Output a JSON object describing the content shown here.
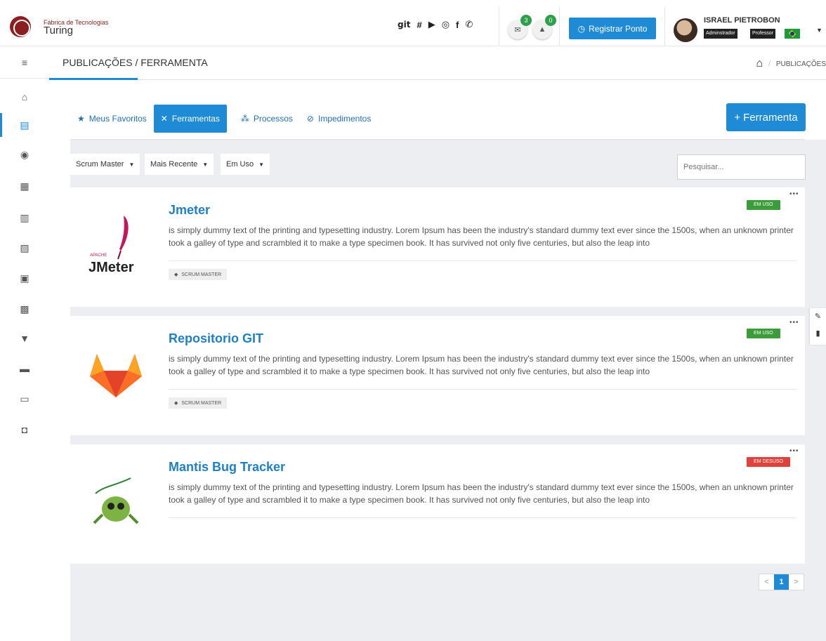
{
  "header": {
    "logo_small": "Fábrica de Tecnologias",
    "logo_big": "Turing",
    "social": [
      "git",
      "slack-icon",
      "youtube-icon",
      "instagram-icon",
      "facebook-icon",
      "whatsapp-icon"
    ],
    "mail_count": "3",
    "notif_count": "0",
    "registrar_label": "Registrar Ponto",
    "user_name": "ISRAEL PIETROBON",
    "roles": [
      "Adminstrador",
      "Professor"
    ]
  },
  "breadcrumb": {
    "title": "PUBLICAÇÕES / FERRAMENTA",
    "right": "PUBLICAÇÕES"
  },
  "tabs": [
    {
      "label": "Meus Favoritos",
      "icon": "star-icon"
    },
    {
      "label": "Ferramentas",
      "icon": "tools-icon"
    },
    {
      "label": "Processos",
      "icon": "process-icon"
    },
    {
      "label": "Impedimentos",
      "icon": "ban-icon"
    }
  ],
  "add_button": "Ferramenta",
  "filters": [
    "Scrum Master",
    "Mais Recente",
    "Em Uso"
  ],
  "search": {
    "placeholder": "Pesquisar..."
  },
  "cards": [
    {
      "title": "Jmeter",
      "description": "is simply dummy text of the printing and typesetting industry. Lorem Ipsum has been the industry's standard dummy text ever since the 1500s, when an unknown printer took a galley of type and scrambled it to make a type specimen book. It has survived not only five centuries, but also the leap into",
      "tag": "SCRUM MASTER",
      "status": "EM USO",
      "status_color": "#3a9d3a"
    },
    {
      "title": "Repositorio GIT",
      "description": "is simply dummy text of the printing and typesetting industry. Lorem Ipsum has been the industry's standard dummy text ever since the 1500s, when an unknown printer took a galley of type and scrambled it to make a type specimen book. It has survived not only five centuries, but also the leap into",
      "tag": "SCRUM MASTER",
      "status": "EM USO",
      "status_color": "#3a9d3a"
    },
    {
      "title": "Mantis Bug Tracker",
      "description": "is simply dummy text of the printing and typesetting industry. Lorem Ipsum has been the industry's standard dummy text ever since the 1500s, when an unknown printer took a galley of type and scrambled it to make a type specimen book. It has survived not only five centuries, but also the leap into",
      "tag": "",
      "status": "EM DESUSO",
      "status_color": "#e0413a"
    }
  ],
  "card_images": {
    "jmeter_small": "APACHE",
    "jmeter_big": "JMeter"
  },
  "pagination": {
    "current": "1",
    "prev": "<",
    "next": ">"
  },
  "colors": {
    "accent": "#1f8bd6",
    "brand": "#8b1e1e"
  }
}
